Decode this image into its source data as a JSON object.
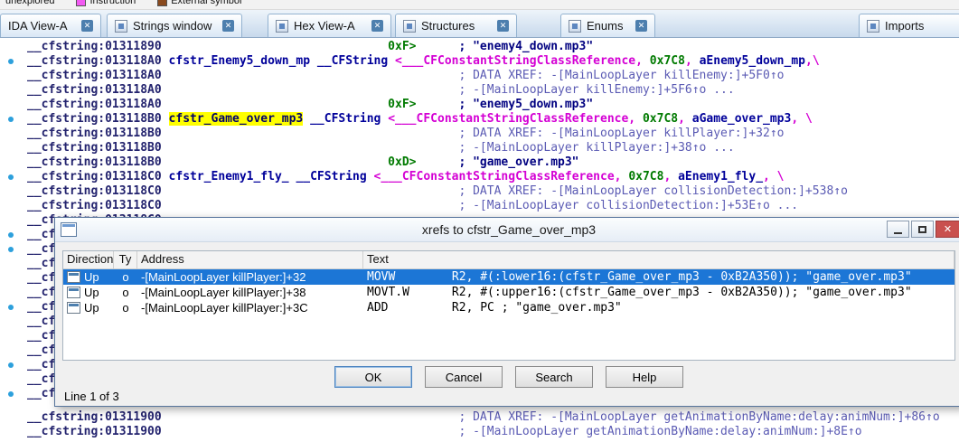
{
  "legend": {
    "items": [
      {
        "label": "unexplored",
        "swatch": null
      },
      {
        "label": "Instruction",
        "swatch": "#f25af2"
      },
      {
        "label": "External symbol",
        "swatch": "#8a4a1e"
      }
    ]
  },
  "tabs": [
    {
      "label": "IDA View-A",
      "icon": null,
      "closable": true
    },
    {
      "label": "Strings window",
      "icon": "strings-window-icon",
      "closable": true
    },
    {
      "label": "Hex View-A",
      "icon": "hex-view-icon",
      "closable": true
    },
    {
      "label": "Structures",
      "icon": "structures-icon",
      "closable": true
    },
    {
      "label": "Enums",
      "icon": "enums-icon",
      "closable": true
    },
    {
      "label": "Imports",
      "icon": "imports-icon",
      "closable": false
    }
  ],
  "disasm": {
    "lines": [
      {
        "dot": false,
        "s": [
          {
            "c": "addr",
            "t": "__cfstring:01311890"
          },
          {
            "c": "pad",
            "n": 32
          },
          {
            "c": "num",
            "t": "0xF>"
          },
          {
            "c": "pad",
            "n": 6
          },
          {
            "c": "str",
            "t": "; \"enemy4_down.mp3\""
          }
        ]
      },
      {
        "dot": true,
        "s": [
          {
            "c": "addr",
            "t": "__cfstring:013118A0"
          },
          {
            "c": "pad",
            "n": 1
          },
          {
            "c": "name",
            "t": "cfstr_Enemy5_down_mp"
          },
          {
            "c": "pad",
            "n": 1
          },
          {
            "c": "kw",
            "t": "__CFString"
          },
          {
            "c": "pad",
            "n": 1
          },
          {
            "c": "ext",
            "t": "<___CFConstantStringClassReference, "
          },
          {
            "c": "num",
            "t": "0x7C8"
          },
          {
            "c": "ext",
            "t": ", "
          },
          {
            "c": "name",
            "t": "aEnemy5_down_mp"
          },
          {
            "c": "ext",
            "t": ",\\"
          }
        ]
      },
      {
        "dot": false,
        "s": [
          {
            "c": "addr",
            "t": "__cfstring:013118A0"
          },
          {
            "c": "pad",
            "n": 42
          },
          {
            "c": "xref",
            "t": "; DATA XREF: -[MainLoopLayer killEnemy:]+5F0↑o"
          }
        ]
      },
      {
        "dot": false,
        "s": [
          {
            "c": "addr",
            "t": "__cfstring:013118A0"
          },
          {
            "c": "pad",
            "n": 42
          },
          {
            "c": "xref",
            "t": "; -[MainLoopLayer killEnemy:]+5F6↑o ..."
          }
        ]
      },
      {
        "dot": false,
        "s": [
          {
            "c": "addr",
            "t": "__cfstring:013118A0"
          },
          {
            "c": "pad",
            "n": 32
          },
          {
            "c": "num",
            "t": "0xF>"
          },
          {
            "c": "pad",
            "n": 6
          },
          {
            "c": "str",
            "t": "; \"enemy5_down.mp3\""
          }
        ]
      },
      {
        "dot": true,
        "s": [
          {
            "c": "addr",
            "t": "__cfstring:013118B0"
          },
          {
            "c": "pad",
            "n": 1
          },
          {
            "c": "hl",
            "t": "cfstr_Game_over_mp3"
          },
          {
            "c": "pad",
            "n": 1
          },
          {
            "c": "kw",
            "t": "__CFString"
          },
          {
            "c": "pad",
            "n": 1
          },
          {
            "c": "ext",
            "t": "<___CFConstantStringClassReference, "
          },
          {
            "c": "num",
            "t": "0x7C8"
          },
          {
            "c": "ext",
            "t": ", "
          },
          {
            "c": "name",
            "t": "aGame_over_mp3"
          },
          {
            "c": "ext",
            "t": ", \\"
          }
        ]
      },
      {
        "dot": false,
        "s": [
          {
            "c": "addr",
            "t": "__cfstring:013118B0"
          },
          {
            "c": "pad",
            "n": 42
          },
          {
            "c": "xref",
            "t": "; DATA XREF: -[MainLoopLayer killPlayer:]+32↑o"
          }
        ]
      },
      {
        "dot": false,
        "s": [
          {
            "c": "addr",
            "t": "__cfstring:013118B0"
          },
          {
            "c": "pad",
            "n": 42
          },
          {
            "c": "xref",
            "t": "; -[MainLoopLayer killPlayer:]+38↑o ..."
          }
        ]
      },
      {
        "dot": false,
        "s": [
          {
            "c": "addr",
            "t": "__cfstring:013118B0"
          },
          {
            "c": "pad",
            "n": 32
          },
          {
            "c": "num",
            "t": "0xD>"
          },
          {
            "c": "pad",
            "n": 6
          },
          {
            "c": "str",
            "t": "; \"game_over.mp3\""
          }
        ]
      },
      {
        "dot": true,
        "s": [
          {
            "c": "addr",
            "t": "__cfstring:013118C0"
          },
          {
            "c": "pad",
            "n": 1
          },
          {
            "c": "name",
            "t": "cfstr_Enemy1_fly_"
          },
          {
            "c": "pad",
            "n": 1
          },
          {
            "c": "kw",
            "t": "__CFString"
          },
          {
            "c": "pad",
            "n": 1
          },
          {
            "c": "ext",
            "t": "<___CFConstantStringClassReference, "
          },
          {
            "c": "num",
            "t": "0x7C8"
          },
          {
            "c": "ext",
            "t": ", "
          },
          {
            "c": "name",
            "t": "aEnemy1_fly_"
          },
          {
            "c": "ext",
            "t": ", \\"
          }
        ]
      },
      {
        "dot": false,
        "s": [
          {
            "c": "addr",
            "t": "__cfstring:013118C0"
          },
          {
            "c": "pad",
            "n": 42
          },
          {
            "c": "xref",
            "t": "; DATA XREF: -[MainLoopLayer collisionDetection:]+538↑o"
          }
        ]
      },
      {
        "dot": false,
        "s": [
          {
            "c": "addr",
            "t": "__cfstring:013118C0"
          },
          {
            "c": "pad",
            "n": 42
          },
          {
            "c": "xref",
            "t": "; -[MainLoopLayer collisionDetection:]+53E↑o ..."
          }
        ]
      },
      {
        "dot": false,
        "s": [
          {
            "c": "addr",
            "t": "__cfstring:013118C0"
          }
        ]
      },
      {
        "dot": true,
        "s": [
          {
            "c": "addr",
            "t": "__cf"
          }
        ]
      },
      {
        "dot": true,
        "s": [
          {
            "c": "addr",
            "t": "__cf"
          }
        ]
      },
      {
        "dot": false,
        "s": [
          {
            "c": "addr",
            "t": "__cf"
          }
        ]
      },
      {
        "dot": false,
        "s": [
          {
            "c": "addr",
            "t": "__cf"
          }
        ]
      },
      {
        "dot": false,
        "s": [
          {
            "c": "addr",
            "t": "__cf"
          }
        ]
      },
      {
        "dot": true,
        "s": [
          {
            "c": "addr",
            "t": "__cf"
          }
        ]
      },
      {
        "dot": false,
        "s": [
          {
            "c": "addr",
            "t": "__cf"
          }
        ]
      },
      {
        "dot": false,
        "s": [
          {
            "c": "addr",
            "t": "__cf"
          }
        ]
      },
      {
        "dot": false,
        "s": [
          {
            "c": "addr",
            "t": "__cf"
          }
        ]
      },
      {
        "dot": true,
        "s": [
          {
            "c": "addr",
            "t": "__cf"
          }
        ]
      },
      {
        "dot": false,
        "s": [
          {
            "c": "addr",
            "t": "__cf"
          }
        ]
      },
      {
        "dot": true,
        "s": [
          {
            "c": "addr",
            "t": "__cf"
          }
        ]
      }
    ],
    "bottom_lines": [
      {
        "dot": false,
        "s": [
          {
            "c": "addr",
            "t": "__cfstring:01311900"
          },
          {
            "c": "pad",
            "n": 42
          },
          {
            "c": "xref",
            "t": "; DATA XREF: -[MainLoopLayer getAnimationByName:delay:animNum:]+86↑o"
          }
        ]
      },
      {
        "dot": false,
        "s": [
          {
            "c": "addr",
            "t": "__cfstring:01311900"
          },
          {
            "c": "pad",
            "n": 42
          },
          {
            "c": "xref",
            "t": "; -[MainLoopLayer getAnimationByName:delay:animNum:]+8E↑o"
          }
        ]
      }
    ]
  },
  "dialog": {
    "title": "xrefs to cfstr_Game_over_mp3",
    "columns": [
      "Direction",
      "Ty",
      "Address",
      "Text"
    ],
    "rows": [
      {
        "direction": "Up",
        "type": "o",
        "address": "-[MainLoopLayer killPlayer:]+32",
        "text": "MOVW        R2, #(:lower16:(cfstr_Game_over_mp3 - 0xB2A350)); \"game_over.mp3\"",
        "selected": true
      },
      {
        "direction": "Up",
        "type": "o",
        "address": "-[MainLoopLayer killPlayer:]+38",
        "text": "MOVT.W      R2, #(:upper16:(cfstr_Game_over_mp3 - 0xB2A350)); \"game_over.mp3\"",
        "selected": false
      },
      {
        "direction": "Up",
        "type": "o",
        "address": "-[MainLoopLayer killPlayer:]+3C",
        "text": "ADD         R2, PC ; \"game_over.mp3\"",
        "selected": false
      }
    ],
    "buttons": [
      "OK",
      "Cancel",
      "Search",
      "Help"
    ],
    "status": "Line 1 of 3",
    "selection_color": "#1c76d6",
    "highlight_color": "#ffff00"
  }
}
